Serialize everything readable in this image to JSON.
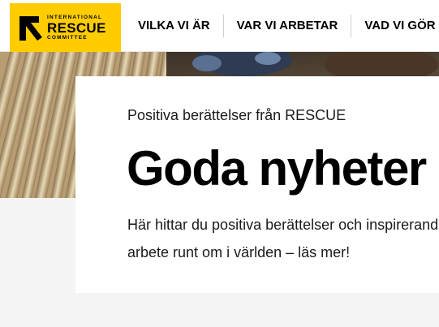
{
  "brand": {
    "logo_top": "INTERNATIONAL",
    "logo_main": "RESCUE",
    "logo_bottom": "COMMITTEE",
    "accent_color": "#ffcc00"
  },
  "nav": {
    "items": [
      {
        "label": "VILKA VI ÄR"
      },
      {
        "label": "VAR VI ARBETAR"
      },
      {
        "label": "VAD VI GÖR"
      }
    ]
  },
  "card": {
    "eyebrow": "Positiva berättelser från RESCUE",
    "title": "Goda nyheter",
    "body_line1": "Här hittar du positiva berättelser och inspirerande",
    "body_line2": "arbete runt om i världen – läs mer!"
  },
  "icons": {
    "logo_mark": "rescue-arrow-icon"
  }
}
